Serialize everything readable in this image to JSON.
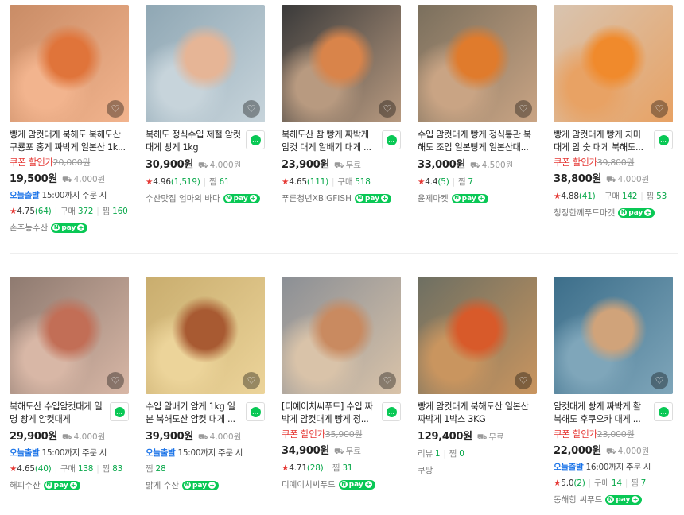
{
  "rows": [
    [
      {
        "title": "빵게 암컷대게 북해도 북해도산 구룡포 홍게 짜박게 일본산 1k...",
        "coupon": "쿠폰 할인가",
        "orig": "20,000원",
        "price": "19,500원",
        "ship": "4,000원",
        "today": "오늘출발",
        "today_text": "15:00까지 주문 시",
        "rating": "4.75",
        "reviews": "(64)",
        "buy_label": "구매",
        "buys": "372",
        "zzim_label": "찜",
        "zzim": "160",
        "seller": "손주농수산",
        "talk": false,
        "colors": [
          "#c98c66",
          "#e0743a",
          "#f2b48e"
        ]
      },
      {
        "title": "북해도 정식수입 제철 암컷대게 빵게 1kg",
        "coupon": "",
        "orig": "",
        "price": "30,900원",
        "ship": "4,000원",
        "today": "",
        "today_text": "",
        "rating": "4.96",
        "reviews": "(1,519)",
        "buy_label": "",
        "buys": "",
        "zzim_label": "찜",
        "zzim": "61",
        "seller": "수산맛집 엄마의 바다",
        "talk": true,
        "colors": [
          "#8fa7b4",
          "#e6b596",
          "#c7d4db"
        ]
      },
      {
        "title": "북해도산 참 빵게 짜박게 암컷 대게 알배기 대게 ...",
        "coupon": "",
        "orig": "",
        "price": "23,900원",
        "ship": "무료",
        "today": "",
        "today_text": "",
        "rating": "4.65",
        "reviews": "(111)",
        "buy_label": "구매",
        "buys": "518",
        "zzim_label": "",
        "zzim": "",
        "seller": "푸른청년XBIGFISH",
        "talk": true,
        "colors": [
          "#3a3a3a",
          "#d9844a",
          "#b89a80"
        ]
      },
      {
        "title": "수입 암컷대게 빵게 정식통관 북해도 조업 일본빵게 일본산대...",
        "coupon": "",
        "orig": "",
        "price": "33,000원",
        "ship": "4,500원",
        "today": "",
        "today_text": "",
        "rating": "4.4",
        "reviews": "(5)",
        "buy_label": "",
        "buys": "",
        "zzim_label": "찜",
        "zzim": "7",
        "seller": "윤제마켓",
        "talk": false,
        "colors": [
          "#7a6f5d",
          "#e07b2c",
          "#c9a484"
        ]
      },
      {
        "title": "빵게 암컷대게 빵게 치미 대게 암 숫 대게 북해도...",
        "coupon": "쿠폰 할인가",
        "orig": "39,800원",
        "price": "38,800원",
        "ship": "4,000원",
        "today": "",
        "today_text": "",
        "rating": "4.88",
        "reviews": "(41)",
        "buy_label": "구매",
        "buys": "142",
        "zzim_label": "찜",
        "zzim": "53",
        "seller": "청정한께푸드마켓",
        "talk": true,
        "colors": [
          "#d8c4b0",
          "#f08a2c",
          "#e8a264"
        ]
      }
    ],
    [
      {
        "title": "북해도산 수입암컷대게 일명 빵게 암컷대게",
        "coupon": "",
        "orig": "",
        "price": "29,900원",
        "ship": "4,000원",
        "today": "오늘출발",
        "today_text": "15:00까지 주문 시",
        "rating": "4.65",
        "reviews": "(40)",
        "buy_label": "구매",
        "buys": "138",
        "zzim_label": "찜",
        "zzim": "83",
        "seller": "해피수산",
        "talk": true,
        "colors": [
          "#8e7a70",
          "#c26e56",
          "#d8b7a6"
        ]
      },
      {
        "title": "수입 알배기 암게 1kg 일본 북해도산 암컷 대게 ...",
        "coupon": "",
        "orig": "",
        "price": "39,900원",
        "ship": "4,000원",
        "today": "오늘출발",
        "today_text": "15:00까지 주문 시",
        "rating": "",
        "reviews": "",
        "buy_label": "",
        "buys": "",
        "zzim_label": "찜",
        "zzim": "28",
        "seller": "밝게 수산",
        "talk": true,
        "colors": [
          "#c9ad6e",
          "#a85a32",
          "#ecd49a"
        ]
      },
      {
        "title": "[디예이치씨푸드] 수입 짜박게 암컷대게 빵게 정...",
        "coupon": "쿠폰 할인가",
        "orig": "35,900원",
        "price": "34,900원",
        "ship": "무료",
        "today": "",
        "today_text": "",
        "rating": "4.71",
        "reviews": "(28)",
        "buy_label": "",
        "buys": "",
        "zzim_label": "찜",
        "zzim": "31",
        "seller": "디예이치씨푸드",
        "talk": true,
        "colors": [
          "#8b8f95",
          "#c98a60",
          "#d9c3a9"
        ]
      },
      {
        "title": "빵게 암컷대게 북해도산 일본산 짜박게 1박스 3KG",
        "coupon": "",
        "orig": "",
        "price": "129,400원",
        "ship": "무료",
        "today": "",
        "today_text": "",
        "rating": "",
        "reviews": "",
        "buy_label": "리뷰",
        "buys": "1",
        "zzim_label": "찜",
        "zzim": "0",
        "seller": "쿠팡",
        "talk": false,
        "colors": [
          "#6d6f62",
          "#d85a2a",
          "#c9955f"
        ]
      },
      {
        "title": "암컷대게 빵게 짜박게 활 북해도 후쿠오카 대게 ...",
        "coupon": "쿠폰 할인가",
        "orig": "23,000원",
        "price": "22,000원",
        "ship": "4,000원",
        "today": "오늘출발",
        "today_text": "16:00까지 주문 시",
        "rating": "5.0",
        "reviews": "(2)",
        "buy_label": "구매",
        "buys": "14",
        "zzim_label": "찜",
        "zzim": "7",
        "seller": "동해항 씨푸드",
        "talk": true,
        "colors": [
          "#3c6e8a",
          "#d0a37a",
          "#7fa6ba"
        ]
      }
    ]
  ],
  "npay_label": "pay",
  "ship_icon": "truck-icon",
  "heart_icon": "heart-icon",
  "talk_icon": "talktalk-icon"
}
